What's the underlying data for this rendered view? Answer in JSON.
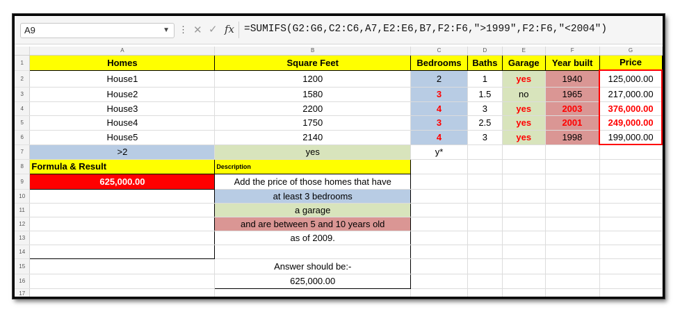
{
  "formula_bar": {
    "name_box": "A9",
    "formula": "=SUMIFS(G2:G6,C2:C6,A7,E2:E6,B7,F2:F6,\">1999\",F2:F6,\"<2004\")"
  },
  "columns": [
    "A",
    "B",
    "C",
    "D",
    "E",
    "F",
    "G"
  ],
  "headers": {
    "homes": "Homes",
    "square_feet": "Square Feet",
    "bedrooms": "Bedrooms",
    "baths": "Baths",
    "garage": "Garage",
    "year_built": "Year built",
    "price": "Price"
  },
  "rows": [
    {
      "home": "House1",
      "sqft": "1200",
      "bed": "2",
      "bath": "1",
      "garage": "yes",
      "year": "1940",
      "price": "125,000.00"
    },
    {
      "home": "House2",
      "sqft": "1580",
      "bed": "3",
      "bath": "1.5",
      "garage": "no",
      "year": "1965",
      "price": "217,000.00"
    },
    {
      "home": "House3",
      "sqft": "2200",
      "bed": "4",
      "bath": "3",
      "garage": "yes",
      "year": "2003",
      "price": "376,000.00"
    },
    {
      "home": "House4",
      "sqft": "1750",
      "bed": "3",
      "bath": "2.5",
      "garage": "yes",
      "year": "2001",
      "price": "249,000.00"
    },
    {
      "home": "House5",
      "sqft": "2140",
      "bed": "4",
      "bath": "3",
      "garage": "yes",
      "year": "1998",
      "price": "199,000.00"
    }
  ],
  "criteria": {
    "bedrooms": ">2",
    "garage": "yes",
    "c7": "y*"
  },
  "formula_label": "Formula & Result",
  "result": "625,000.00",
  "description": {
    "label": "Description",
    "line1": "Add the price of those homes that have",
    "line2": "at least 3 bedrooms",
    "line3": "a garage",
    "line4": "and are between 5 and 10 years old",
    "line5": "as of 2009.",
    "line6": "Answer should be:-",
    "line7": "625,000.00"
  },
  "colors": {
    "header_yellow": "#ffff00",
    "criteria_blue": "#b8cce4",
    "criteria_green": "#d8e4bc",
    "criteria_rose": "#da9694",
    "highlight_red": "#ff0000"
  }
}
